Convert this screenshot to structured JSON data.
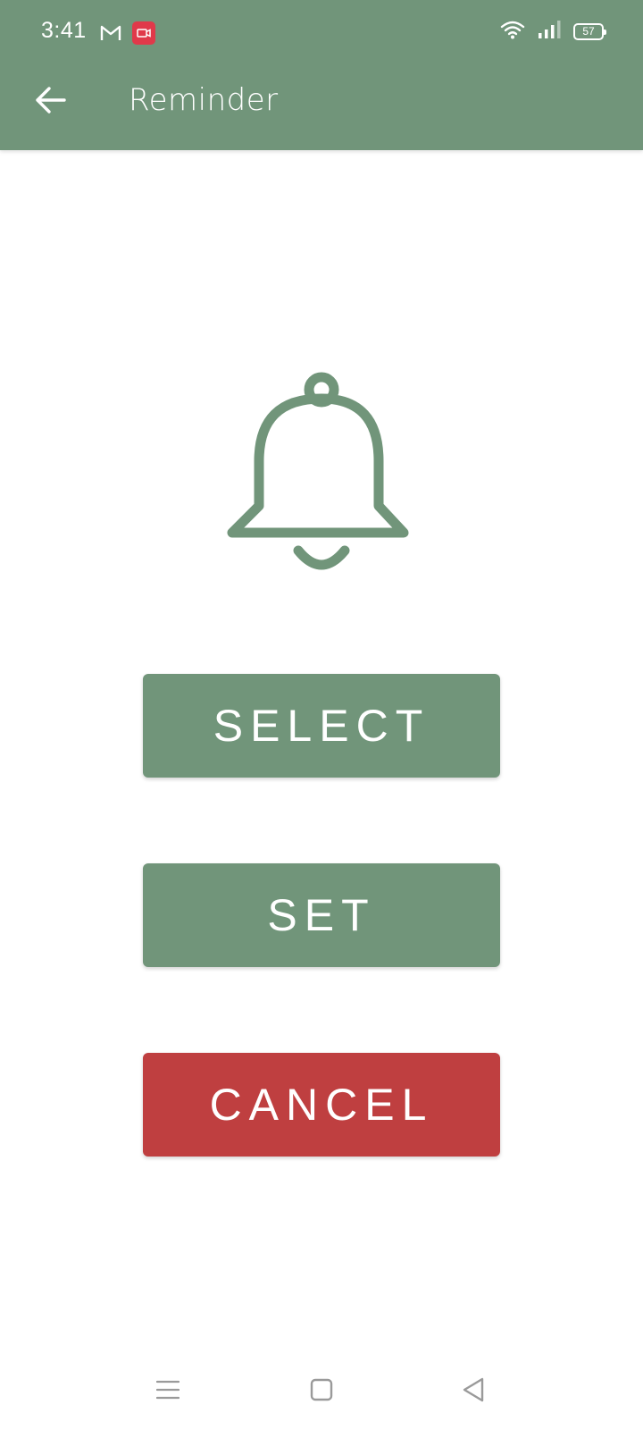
{
  "status_bar": {
    "time": "3:41",
    "battery_level": "57",
    "icons": [
      "gmail-icon",
      "screen-record-icon",
      "wifi-icon",
      "signal-icon",
      "battery-icon"
    ]
  },
  "app_bar": {
    "title": "Reminder",
    "back_icon": "arrow-left-icon"
  },
  "main": {
    "icon": "bell-icon",
    "buttons": {
      "select": "SELECT",
      "set": "SET",
      "cancel": "CANCEL"
    }
  },
  "nav_bar": {
    "items": [
      "menu-icon",
      "home-square-icon",
      "back-triangle-icon"
    ]
  },
  "colors": {
    "primary": "#71957a",
    "danger": "#bf3f40",
    "background": "#ffffff"
  }
}
